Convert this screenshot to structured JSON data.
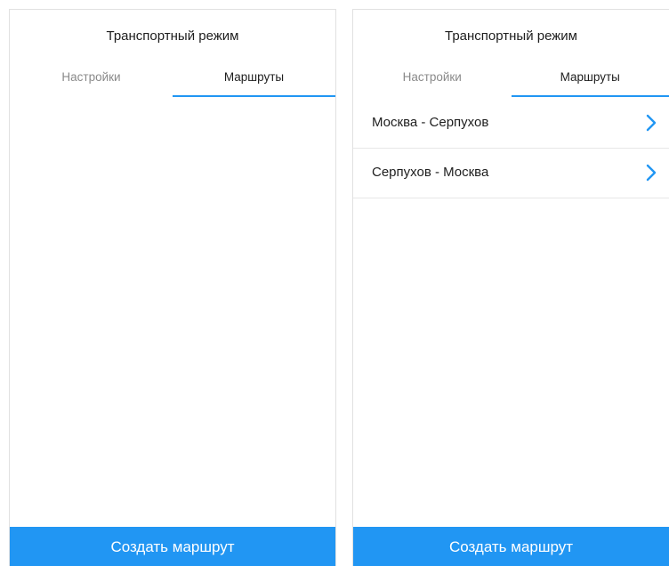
{
  "accent_color": "#2196f3",
  "screens": [
    {
      "title": "Транспортный режим",
      "tabs": [
        {
          "label": "Настройки",
          "active": false
        },
        {
          "label": "Маршруты",
          "active": true
        }
      ],
      "routes": [],
      "create_button_label": "Создать маршрут"
    },
    {
      "title": "Транспортный режим",
      "tabs": [
        {
          "label": "Настройки",
          "active": false
        },
        {
          "label": "Маршруты",
          "active": true
        }
      ],
      "routes": [
        {
          "label": "Москва - Серпухов",
          "icon": "chevron-right-icon"
        },
        {
          "label": "Серпухов - Москва",
          "icon": "chevron-right-icon"
        }
      ],
      "create_button_label": "Создать маршрут"
    }
  ]
}
